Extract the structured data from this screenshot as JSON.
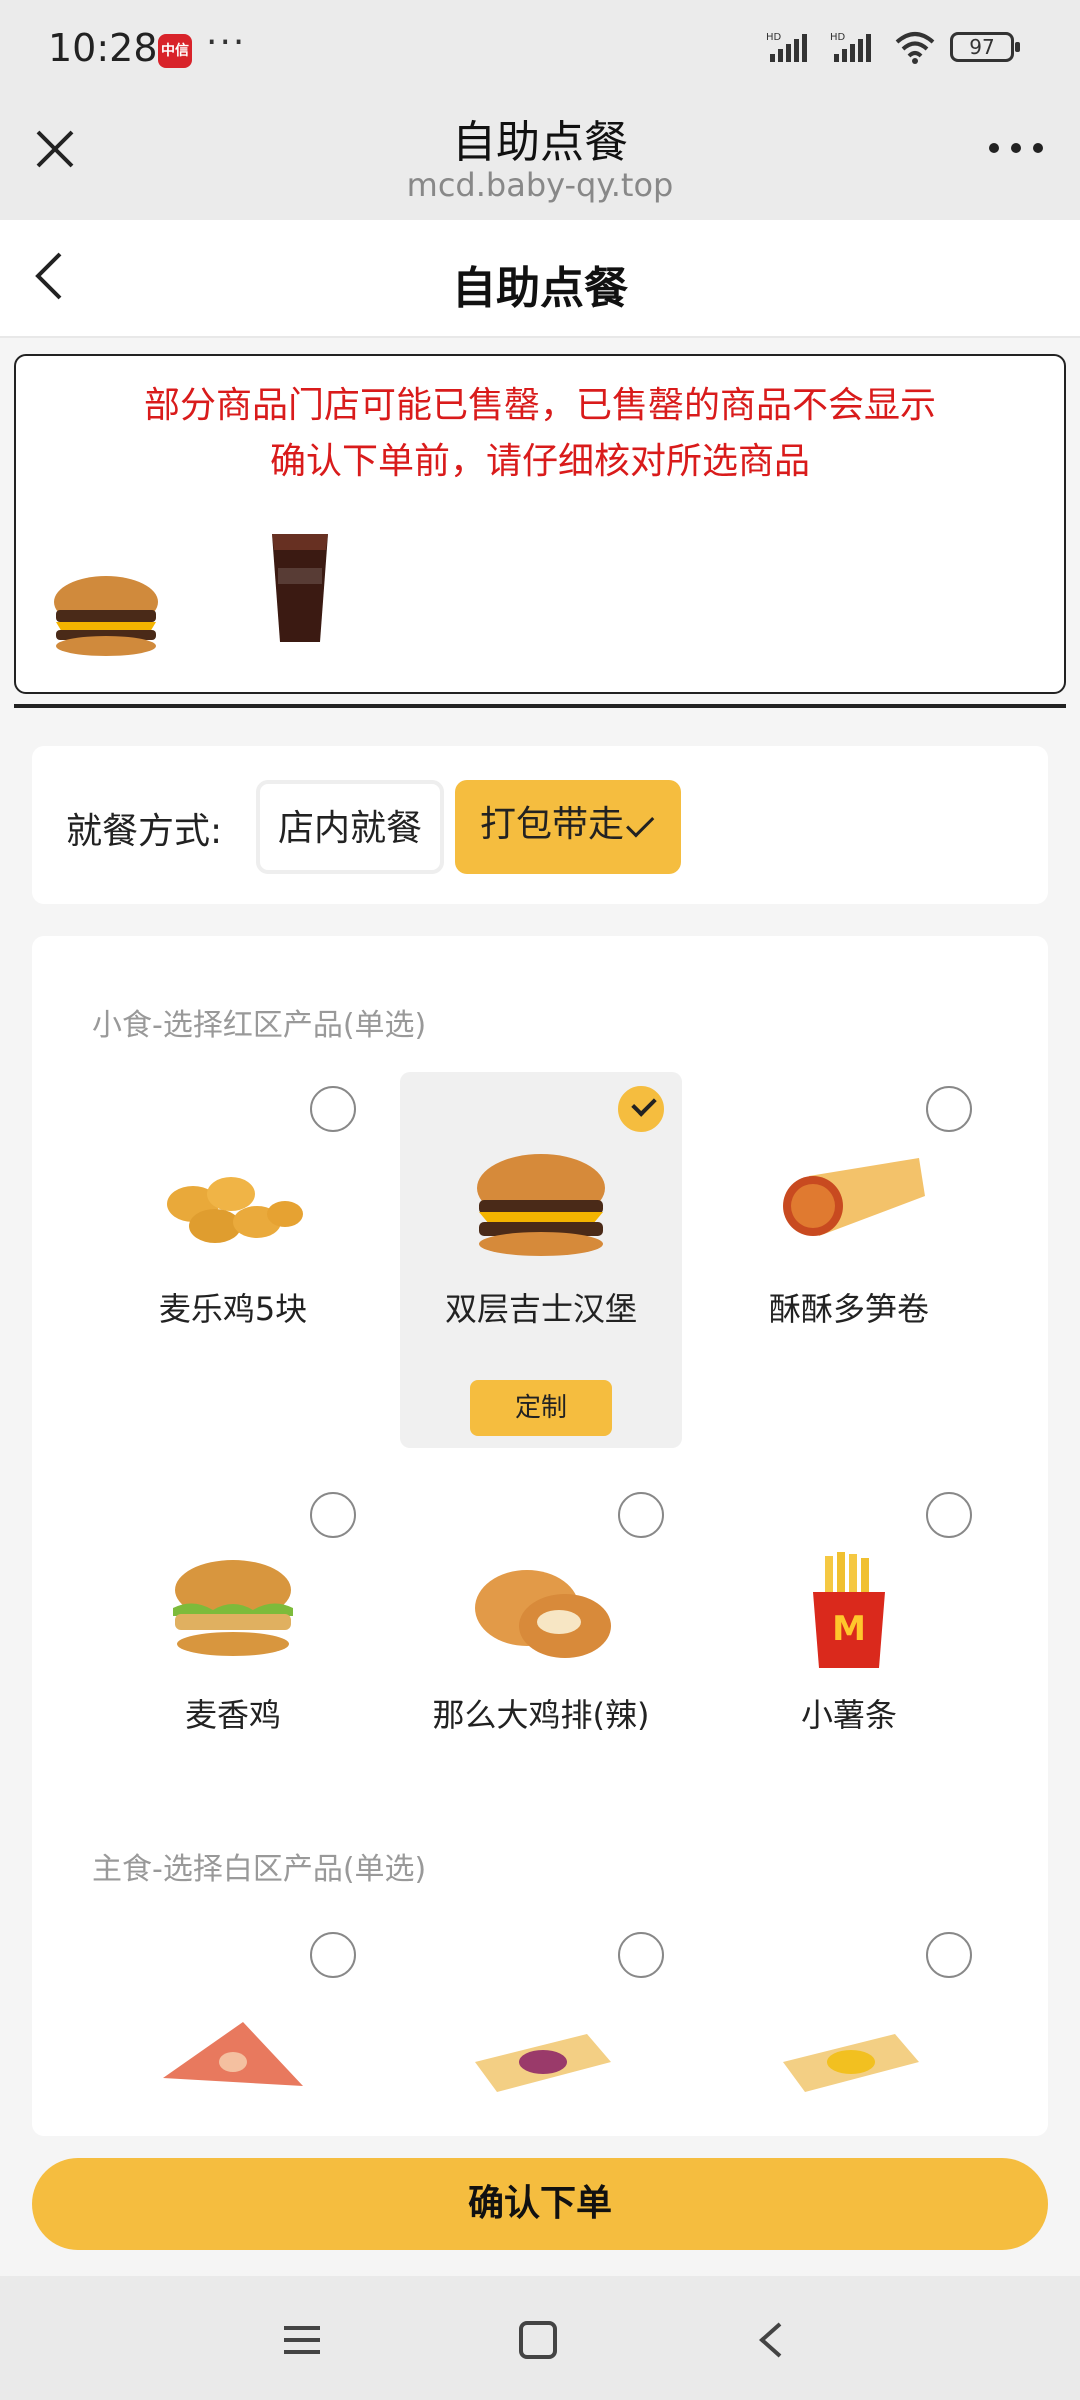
{
  "status_bar": {
    "time": "10:28",
    "app_icon_label": "中信",
    "battery": "97",
    "network": "HD",
    "dots": "···"
  },
  "browser": {
    "title": "自助点餐",
    "url": "mcd.baby-qy.top"
  },
  "header": {
    "title": "自助点餐"
  },
  "notice": {
    "line1": "部分商品门店可能已售罄，已售罄的商品不会显示",
    "line2": "确认下单前，请仔细核对所选商品"
  },
  "dining": {
    "label": "就餐方式:",
    "options": [
      "店内就餐",
      "打包带走"
    ],
    "selected": "打包带走"
  },
  "sections": [
    {
      "title": "小食-选择红区产品(单选)",
      "items": [
        {
          "name": "麦乐鸡5块",
          "selected": false
        },
        {
          "name": "双层吉士汉堡",
          "selected": true,
          "action": "定制"
        },
        {
          "name": "酥酥多笋卷",
          "selected": false
        },
        {
          "name": "麦香鸡",
          "selected": false
        },
        {
          "name": "那么大鸡排(辣)",
          "selected": false
        },
        {
          "name": "小薯条",
          "selected": false
        }
      ]
    },
    {
      "title": "主食-选择白区产品(单选)",
      "items": [
        {
          "name": "",
          "selected": false
        },
        {
          "name": "",
          "selected": false
        },
        {
          "name": "",
          "selected": false
        }
      ]
    }
  ],
  "confirm_label": "确认下单",
  "colors": {
    "accent": "#f5bd3f",
    "notice_red": "#d91b1b"
  }
}
